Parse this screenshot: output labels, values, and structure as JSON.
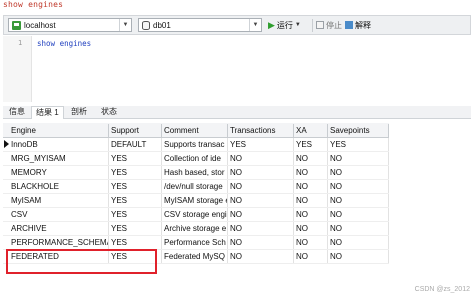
{
  "command": "show engines",
  "toolbar": {
    "connection": "localhost",
    "database": "db01",
    "run_label": "运行",
    "stop_label": "停止",
    "explain_label": "解释"
  },
  "editor": {
    "line_number": "1",
    "code": "show engines"
  },
  "tabs": [
    {
      "label": "信息"
    },
    {
      "label": "结果 1"
    },
    {
      "label": "剖析"
    },
    {
      "label": "状态"
    }
  ],
  "columns": [
    "Engine",
    "Support",
    "Comment",
    "Transactions",
    "XA",
    "Savepoints"
  ],
  "rows": [
    [
      "InnoDB",
      "DEFAULT",
      "Supports transac",
      "YES",
      "YES",
      "YES"
    ],
    [
      "MRG_MYISAM",
      "YES",
      "Collection of ide",
      "NO",
      "NO",
      "NO"
    ],
    [
      "MEMORY",
      "YES",
      "Hash based, stor",
      "NO",
      "NO",
      "NO"
    ],
    [
      "BLACKHOLE",
      "YES",
      "/dev/null storage",
      "NO",
      "NO",
      "NO"
    ],
    [
      "MyISAM",
      "YES",
      "MyISAM storage e",
      "NO",
      "NO",
      "NO"
    ],
    [
      "CSV",
      "YES",
      "CSV storage engi",
      "NO",
      "NO",
      "NO"
    ],
    [
      "ARCHIVE",
      "YES",
      "Archive storage e",
      "NO",
      "NO",
      "NO"
    ],
    [
      "PERFORMANCE_SCHEMA",
      "YES",
      "Performance Sch",
      "NO",
      "NO",
      "NO"
    ],
    [
      "FEDERATED",
      "YES",
      "Federated MySQ",
      "NO",
      "NO",
      "NO"
    ]
  ],
  "watermark": "CSDN @zs_2012",
  "colors": {
    "highlight": "#e0212b",
    "run_icon": "#2f9e2f",
    "code": "#1f3fbf"
  }
}
